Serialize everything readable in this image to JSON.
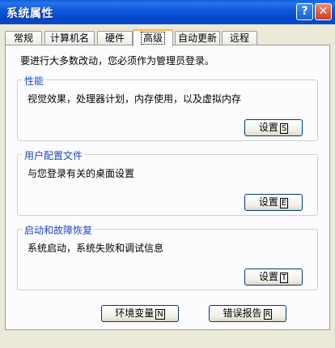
{
  "window": {
    "title": "系统属性",
    "help_glyph": "?",
    "close_glyph": "✕"
  },
  "tabs": [
    {
      "label": "常规",
      "active": false
    },
    {
      "label": "计算机名",
      "active": false
    },
    {
      "label": "硬件",
      "active": false
    },
    {
      "label": "高级",
      "active": true
    },
    {
      "label": "自动更新",
      "active": false
    },
    {
      "label": "远程",
      "active": false
    }
  ],
  "panel": {
    "intro": "要进行大多数改动，您必须作为管理员登录。",
    "groups": [
      {
        "title": "性能",
        "description": "视觉效果，处理器计划，内存使用，以及虚拟内存",
        "button": "设置",
        "accel": "S"
      },
      {
        "title": "用户配置文件",
        "description": "与您登录有关的桌面设置",
        "button": "设置",
        "accel": "E"
      },
      {
        "title": "启动和故障恢复",
        "description": "系统启动，系统失败和调试信息",
        "button": "设置",
        "accel": "T"
      }
    ],
    "env_button": "环境变量",
    "env_accel": "N",
    "error_button": "错误报告",
    "error_accel": "R"
  },
  "colors": {
    "titlebar": "#0545c8",
    "group_title": "#1d46c0",
    "active_tab_top": "#f3b74a"
  }
}
